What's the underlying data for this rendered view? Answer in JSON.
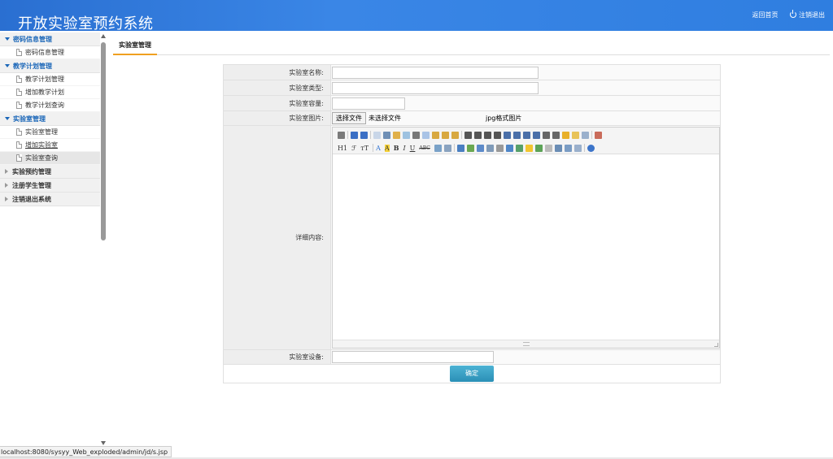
{
  "header": {
    "title": "开放实验室预约系统",
    "home_link": "返回首页",
    "logout_link": "注销退出"
  },
  "sidebar": {
    "groups": [
      {
        "label": "密码信息管理",
        "expanded": true,
        "items": [
          {
            "label": "密码信息管理"
          }
        ]
      },
      {
        "label": "教学计划管理",
        "expanded": true,
        "items": [
          {
            "label": "教学计划管理"
          },
          {
            "label": "增加教学计划"
          },
          {
            "label": "教学计划查询"
          }
        ]
      },
      {
        "label": "实验室管理",
        "expanded": true,
        "items": [
          {
            "label": "实验室管理"
          },
          {
            "label": "增加实验室",
            "hovered": true
          },
          {
            "label": "实验室查询",
            "selected": true
          }
        ]
      },
      {
        "label": "实验预约管理",
        "expanded": false
      },
      {
        "label": "注册学生管理",
        "expanded": false
      },
      {
        "label": "注销退出系统",
        "expanded": false
      }
    ]
  },
  "main": {
    "tab_label": "实验室管理",
    "form": {
      "name_label": "实验室名称:",
      "name_value": "",
      "type_label": "实验室类型:",
      "type_value": "",
      "capacity_label": "实验室容量:",
      "capacity_value": "",
      "image_label": "实验室图片:",
      "file_button": "选择文件",
      "file_status": "未选择文件",
      "image_hint": "jpg格式图片",
      "detail_label": "详细内容:",
      "detail_value": "",
      "equipment_label": "实验室设备:",
      "equipment_value": "",
      "submit_label": "确定"
    },
    "editor_toolbar": {
      "heading_button": "H1",
      "font_family_button": "ℱ",
      "font_size_button": "тT",
      "font_color_button": "A",
      "highlight_button": "A",
      "bold_button": "B",
      "italic_button": "I",
      "underline_button": "U",
      "strike_button": "ABC"
    }
  },
  "status_bar": {
    "url": "localhost:8080/sysyy_Web_exploded/admin/jd/s.jsp"
  },
  "colors": {
    "header_blue": "#3a86e6",
    "menu_active_blue": "#1a66b8",
    "tab_underline": "#f0a020",
    "submit_button": "#2a8fb6"
  }
}
